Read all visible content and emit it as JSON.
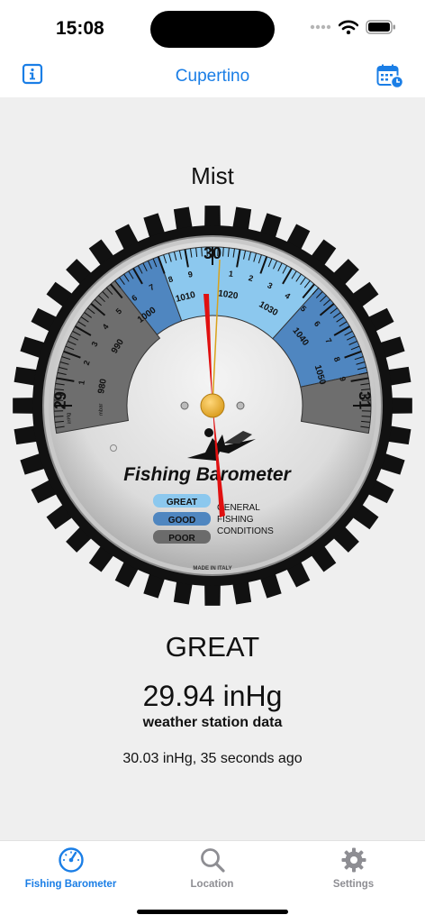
{
  "status": {
    "time": "15:08"
  },
  "nav": {
    "title": "Cupertino",
    "info_icon": "info-icon",
    "calendar_icon": "calendar-clock-icon"
  },
  "main": {
    "condition": "Mist",
    "rating": "GREAT",
    "pressure": "29.94 inHg",
    "source": "weather station data",
    "reading": "30.03 inHg, 35 seconds ago"
  },
  "gauge": {
    "title": "Fishing Barometer",
    "inhg_labels": [
      "29",
      "30",
      "31"
    ],
    "inhg_unit": "inHg",
    "mbar_labels": [
      "980",
      "990",
      "1000",
      "1010",
      "1020",
      "1030",
      "1040",
      "1050"
    ],
    "mbar_unit": "mbar",
    "minor_labels": [
      "1",
      "2",
      "3",
      "4",
      "5",
      "6",
      "7",
      "8",
      "9"
    ],
    "legend": [
      "GREAT",
      "GOOD",
      "POOR"
    ],
    "legend_caption": [
      "GENERAL",
      "FISHING",
      "CONDITIONS"
    ],
    "made_in": "MADE IN ITALY",
    "colors": {
      "great": "#8cc8ee",
      "good": "#4f86c0",
      "poor": "#6b6b6b"
    }
  },
  "tabs": [
    {
      "label": "Fishing Barometer",
      "icon": "gauge-icon",
      "active": true
    },
    {
      "label": "Location",
      "icon": "magnifier-icon",
      "active": false
    },
    {
      "label": "Settings",
      "icon": "gear-icon",
      "active": false
    }
  ],
  "colors": {
    "accent": "#1a7ee6",
    "needle": "#e01010",
    "inactive": "#8e8e93"
  }
}
